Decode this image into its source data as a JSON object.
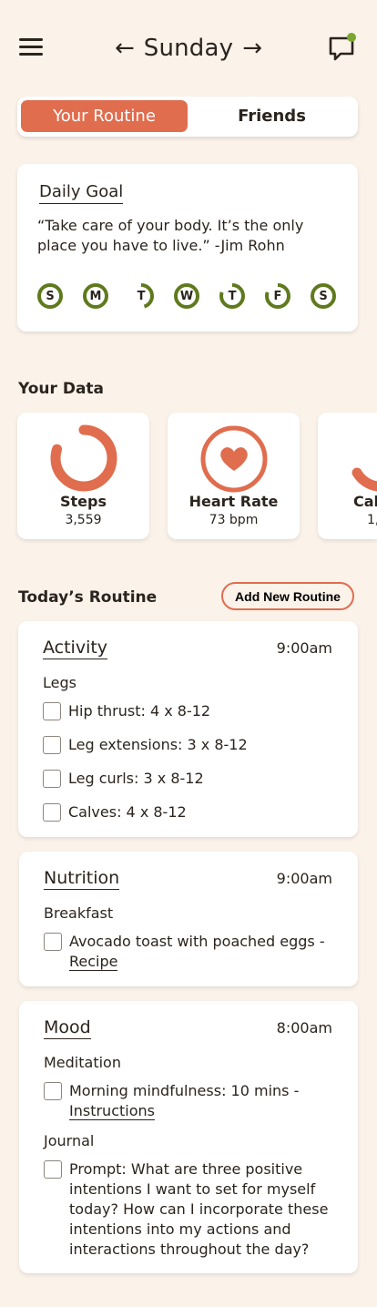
{
  "header": {
    "day": "Sunday",
    "prev_arrow": "←",
    "next_arrow": "→"
  },
  "tabs": [
    {
      "label": "Your Routine",
      "active": true
    },
    {
      "label": "Friends",
      "active": false
    }
  ],
  "daily_goal": {
    "title": "Daily Goal",
    "quote": "“Take care of your body. It’s the only place you have to live.” -Jim Rohn",
    "days": [
      {
        "letter": "S",
        "progress": 1.0
      },
      {
        "letter": "M",
        "progress": 1.0
      },
      {
        "letter": "T",
        "progress": 0.45
      },
      {
        "letter": "W",
        "progress": 1.0
      },
      {
        "letter": "T",
        "progress": 0.8
      },
      {
        "letter": "F",
        "progress": 0.8
      },
      {
        "letter": "S",
        "progress": 1.0
      }
    ]
  },
  "your_data": {
    "title": "Your Data",
    "cards": [
      {
        "label": "Steps",
        "value": "3,559",
        "ring_progress": 0.8
      },
      {
        "label": "Heart Rate",
        "value": "73 bpm"
      },
      {
        "label": "Cal",
        "value": "1,"
      }
    ]
  },
  "todays_routine": {
    "title": "Today’s Routine",
    "add_button": "Add New Routine",
    "sections": [
      {
        "title": "Activity",
        "time": "9:00am",
        "groups": [
          {
            "label": "Legs",
            "tasks": [
              {
                "text": "Hip thrust: 4 x 8-12"
              },
              {
                "text": "Leg extensions: 3 x 8-12"
              },
              {
                "text": "Leg curls: 3 x 8-12"
              },
              {
                "text": "Calves: 4 x 8-12"
              }
            ]
          }
        ]
      },
      {
        "title": "Nutrition",
        "time": "9:00am",
        "groups": [
          {
            "label": "Breakfast",
            "tasks": [
              {
                "text": "Avocado toast with poached eggs -",
                "link": "Recipe"
              }
            ]
          }
        ]
      },
      {
        "title": "Mood",
        "time": "8:00am",
        "groups": [
          {
            "label": "Meditation",
            "tasks": [
              {
                "text": "Morning mindfulness: 10 mins -",
                "link": "Instructions"
              }
            ]
          },
          {
            "label": "Journal",
            "tasks": [
              {
                "text": "Prompt: What are three positive intentions I want to set for myself today? How can I incorporate these intentions into my actions and interactions throughout the day?"
              }
            ]
          }
        ]
      }
    ]
  },
  "colors": {
    "accent": "#e06d4e",
    "green": "#5f7a1d",
    "background": "#fbf3ea",
    "notification_dot": "#7aa62f"
  }
}
